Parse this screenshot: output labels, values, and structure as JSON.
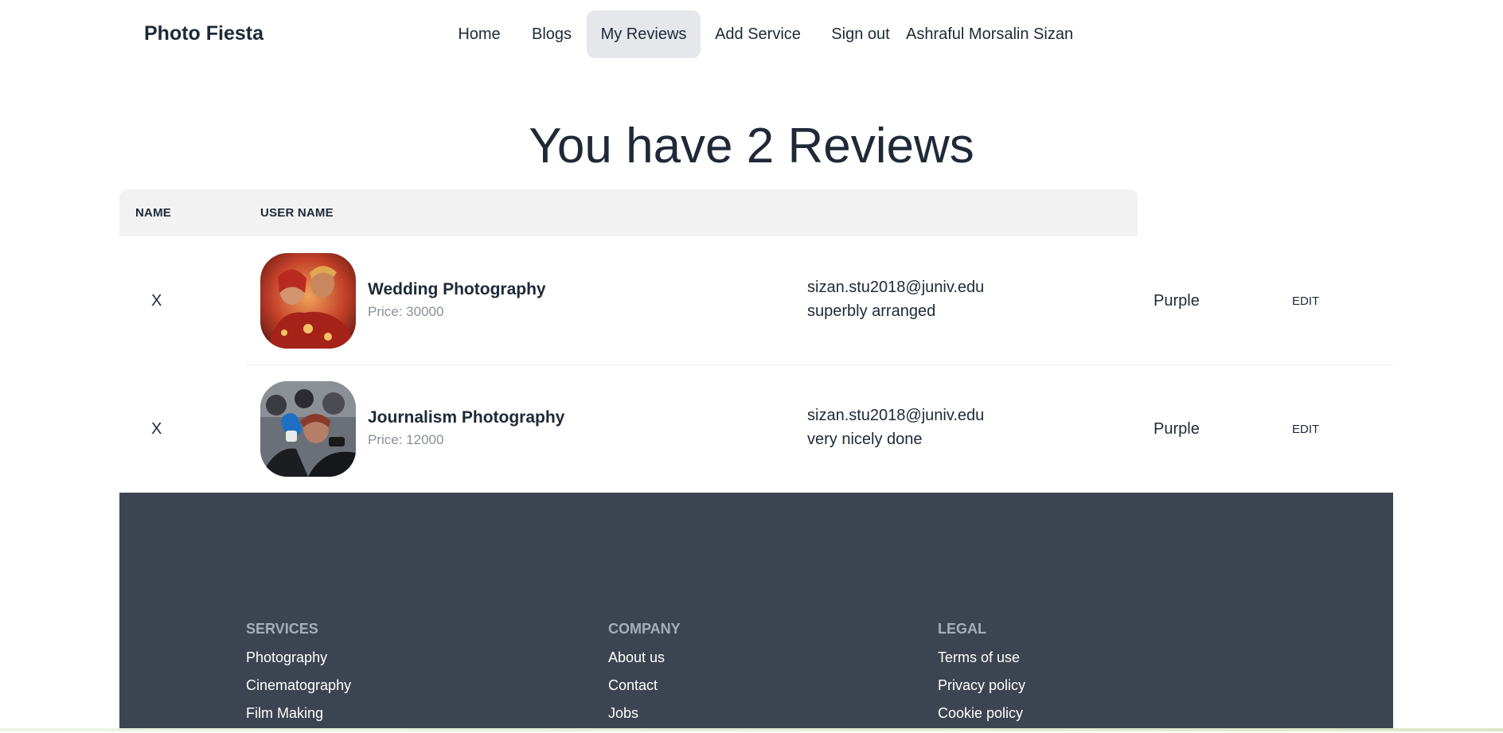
{
  "navbar": {
    "brand": "Photo Fiesta",
    "links": [
      "Home",
      "Blogs",
      "My Reviews",
      "Add Service",
      "Sign out"
    ],
    "active": "My Reviews",
    "user_name": "Ashraful Morsalin Sizan"
  },
  "heading": "You have 2 Reviews",
  "table": {
    "headers": [
      "NAME",
      "USER NAME"
    ],
    "rows": [
      {
        "delete_label": "X",
        "title": "Wedding Photography",
        "price": "Price: 30000",
        "email": "sizan.stu2018@juniv.edu",
        "review": "superbly arranged",
        "color": "Purple",
        "edit_label": "EDIT",
        "image_icon": "wedding-photo-thumbnail"
      },
      {
        "delete_label": "X",
        "title": "Journalism Photography",
        "price": "Price: 12000",
        "email": "sizan.stu2018@juniv.edu",
        "review": "very nicely done",
        "color": "Purple",
        "edit_label": "EDIT",
        "image_icon": "journalism-photo-thumbnail"
      }
    ]
  },
  "footer": {
    "columns": [
      {
        "title": "Services",
        "links": [
          "Photography",
          "Cinematography",
          "Film Making"
        ]
      },
      {
        "title": "Company",
        "links": [
          "About us",
          "Contact",
          "Jobs"
        ]
      },
      {
        "title": "Legal",
        "links": [
          "Terms of use",
          "Privacy policy",
          "Cookie policy"
        ]
      }
    ]
  },
  "colors": {
    "text": "#1f2937",
    "nav_active_bg": "#e5e7eb",
    "table_header_bg": "#f2f2f2",
    "footer_bg": "#3d4451",
    "footer_title": "#a6adbb",
    "price": "#8a8f98"
  }
}
